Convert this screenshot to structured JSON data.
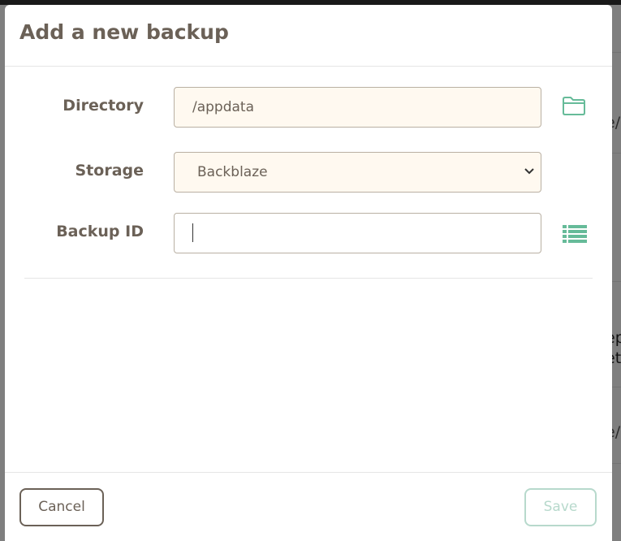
{
  "modal": {
    "title": "Add a new backup"
  },
  "form": {
    "directory": {
      "label": "Directory",
      "value": "/appdata"
    },
    "storage": {
      "label": "Storage",
      "selected": "Backblaze"
    },
    "backup_id": {
      "label": "Backup ID",
      "value": ""
    }
  },
  "icons": {
    "directory_browse": "folder-icon",
    "backup_id_list": "list-icon",
    "storage_dropdown": "chevron-down-icon"
  },
  "footer": {
    "cancel_label": "Cancel",
    "save_label": "Save"
  },
  "background": {
    "fragments": [
      "e/",
      "ep",
      "et",
      "e/"
    ]
  },
  "colors": {
    "accent": "#66bb99",
    "text": "#6b6157",
    "input_bg": "#fff9f0",
    "save_disabled": "#b7d9cc"
  }
}
